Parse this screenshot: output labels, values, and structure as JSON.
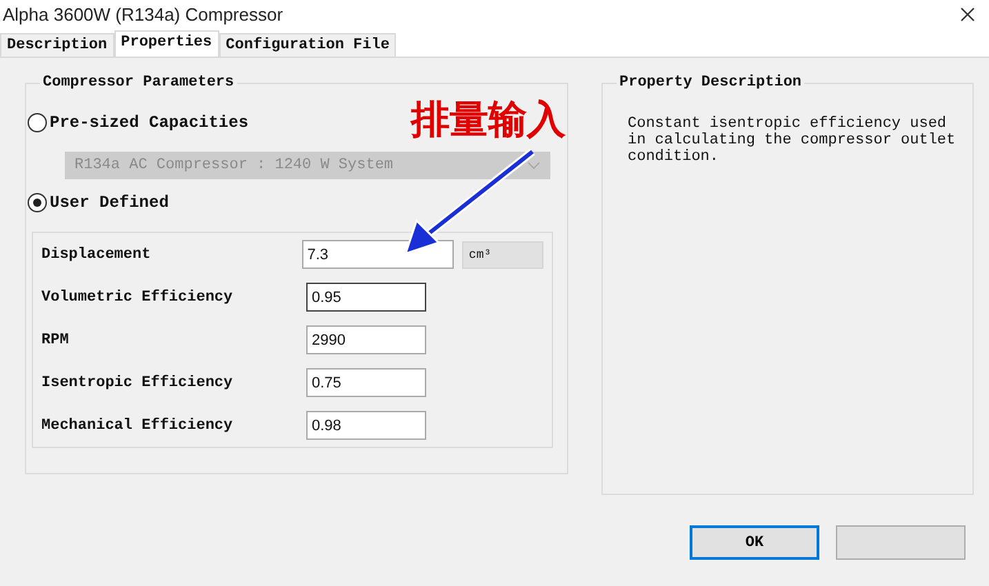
{
  "window": {
    "title": "Alpha 3600W (R134a) Compressor"
  },
  "tabs": [
    {
      "label": "Description",
      "selected": false
    },
    {
      "label": "Properties",
      "selected": true
    },
    {
      "label": "Configuration File",
      "selected": false
    }
  ],
  "compressor_parameters": {
    "title": "Compressor Parameters",
    "options": [
      {
        "label": "Pre-sized Capacities",
        "selected": false
      },
      {
        "label": "User Defined",
        "selected": true
      }
    ],
    "capacity_dropdown": {
      "value": "R134a AC Compressor : 1240 W System",
      "disabled": true
    },
    "fields": [
      {
        "label": "Displacement",
        "value": "7.3",
        "unit": "cm³",
        "wide": true,
        "focused": false
      },
      {
        "label": "Volumetric Efficiency",
        "value": "0.95",
        "wide": false,
        "focused": true
      },
      {
        "label": "RPM",
        "value": "2990",
        "wide": false,
        "focused": false
      },
      {
        "label": "Isentropic Efficiency",
        "value": "0.75",
        "wide": false,
        "focused": false
      },
      {
        "label": "Mechanical Efficiency",
        "value": "0.98",
        "wide": false,
        "focused": false
      }
    ]
  },
  "property_description": {
    "title": "Property Description",
    "text": "Constant isentropic efficiency used in calculating the compressor outlet condition."
  },
  "annotation": {
    "text": "排量输入"
  },
  "buttons": [
    {
      "label": "OK",
      "default": true
    },
    {
      "default": false
    }
  ]
}
